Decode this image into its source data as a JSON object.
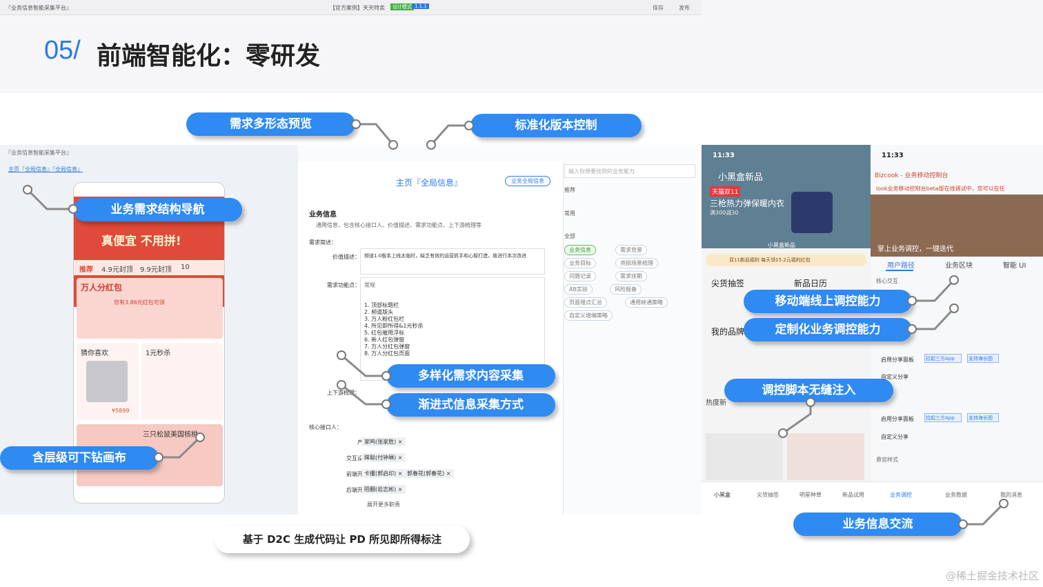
{
  "header": {
    "number": "05/",
    "title": "前端智能化：零研发"
  },
  "callouts": {
    "c1": "需求多形态预览",
    "c2": "标准化版本控制",
    "c3": "业务需求结构导航",
    "c4": "含层级可下钻画布",
    "c5": "多样化需求内容采集",
    "c6": "渐进式信息采集方式",
    "c7": "移动端线上调控能力",
    "c8": "定制化业务调控能力",
    "c9": "调控脚本无缝注入",
    "c10": "业务信息交流"
  },
  "bottom_note": "基于 D2C 生成代码让 PD 所见即所得标注",
  "watermark": "@稀土掘金技术社区",
  "editor": {
    "app_title": "『业务信息智能采集平台』",
    "breadcrumb": "主页『全局信息』『全局信息』",
    "case_title": "【官方案例】天天特卖",
    "version_tag": "设计模式",
    "version_num": "1.1.1",
    "save": "保存",
    "publish": "发布",
    "home_title": "主页『全局信息』",
    "home_btn": "业务全局信息",
    "section": "业务信息",
    "section_desc": "通用信息，包含核心接口人、价值描述、需求功能点、上下游梳理等",
    "req_label": "需求简述：",
    "value_label": "价值描述：",
    "value_text": "频道1.0版本上线太临时，缺乏有效的运营抓手和心智打造，故进行本次改进",
    "func_label": "需求功能点：",
    "toolbar_select": "常规",
    "list": [
      "顶部标题栏",
      "频道版头",
      "万人粉红包栏",
      "所见即所得&1元秒杀",
      "红包催用浮标",
      "新人红包弹窗",
      "万人分红包弹窗",
      "万人分红包页面"
    ],
    "updown_label": "上下游梳理：",
    "owner_label": "核心接口人：",
    "owners": [
      {
        "k": "产品：",
        "v": "家鸣(张家胜) ×"
      },
      {
        "k": "交互设计：",
        "v": "睐聪(付钟琳) ×"
      },
      {
        "k": "前端开发：",
        "v": "卡攫(郭启印) ×",
        "v2": "郭春花(郭春花) ×"
      },
      {
        "k": "后端开发：",
        "v": "陌翻(岩志彬) ×"
      }
    ],
    "expand": "展开更多职责",
    "search_ph": "输入你想要找到的业务能力",
    "rec": "推荐",
    "common": "常用",
    "all": "全部",
    "tags": [
      "业务信息",
      "需求背景",
      "业务目标",
      "资损场景梳理",
      "问题记录",
      "需求排期",
      "AB实验",
      "风险报备",
      "页面埋点汇总",
      "通用映通策略",
      "自定义增编策略"
    ]
  },
  "phone1": {
    "banner": "真便宜 不用拼!",
    "tabs": [
      "推荐",
      "4.9元封顶",
      "9.9元封顶",
      "10"
    ],
    "hb_title": "万人分红包",
    "hb_text": "您有3.86元红包可领",
    "cards": [
      "猜你喜欢",
      "1元秒杀",
      "三只松鼠美国核桃"
    ],
    "price": "¥5899"
  },
  "phone2": {
    "time": "11:33",
    "title": "小黑盒新品",
    "promo_tag": "天猫双11",
    "promo_title": "三枪热力弹保暖内衣",
    "promo_sub": "满300减30",
    "brand": "小黑盒新品",
    "bar": "双11新品福利 每天领15.2元福利红包",
    "sections": [
      "尖货抽签",
      "新品日历",
      "我的品牌",
      "热度新"
    ],
    "tabbar": [
      "小黑盒",
      "尖货抽签",
      "明星种草",
      "新品试用"
    ]
  },
  "phone3": {
    "time": "11:33",
    "title": "Bizcook - 业务移动控制台",
    "notice": "look业务移动控制台beta版在线调试中，您可以在任",
    "hero": "掌上业务调控，一键迭代",
    "tabs": [
      "用户路径",
      "业务区块",
      "智能 UI"
    ],
    "rows": [
      "核心交互",
      "启用分享面板",
      "自定义分享",
      "启用分享面板",
      "自定义分享",
      "悬官样式"
    ],
    "chips": [
      "拉起三方App",
      "支持海长图"
    ],
    "tabbar": [
      "业务调控",
      "业务数据",
      "我的消息"
    ]
  }
}
